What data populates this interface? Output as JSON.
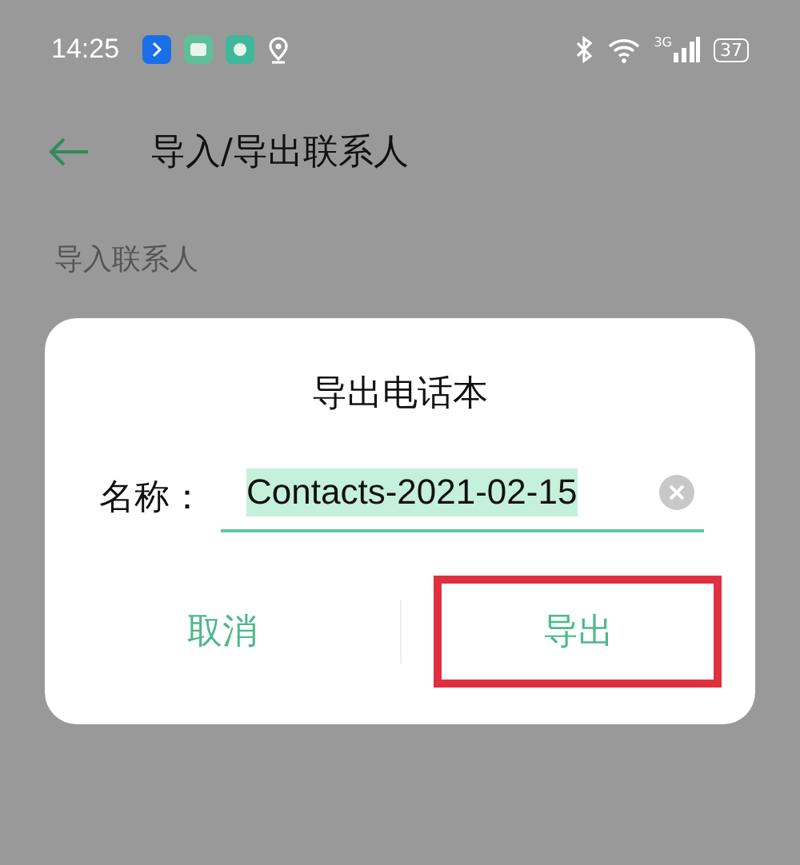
{
  "status_bar": {
    "time": "14:25",
    "network": "3G",
    "battery": "37"
  },
  "app_bar": {
    "title": "导入/导出联系人"
  },
  "section_header": "导入联系人",
  "dialog": {
    "title": "导出电话本",
    "field": {
      "label": "名称：",
      "value": "Contacts-2021-02-15",
      "selected": true
    },
    "buttons": [
      {
        "label": "取消",
        "highlighted": false
      },
      {
        "label": "导出",
        "highlighted": true
      }
    ]
  }
}
